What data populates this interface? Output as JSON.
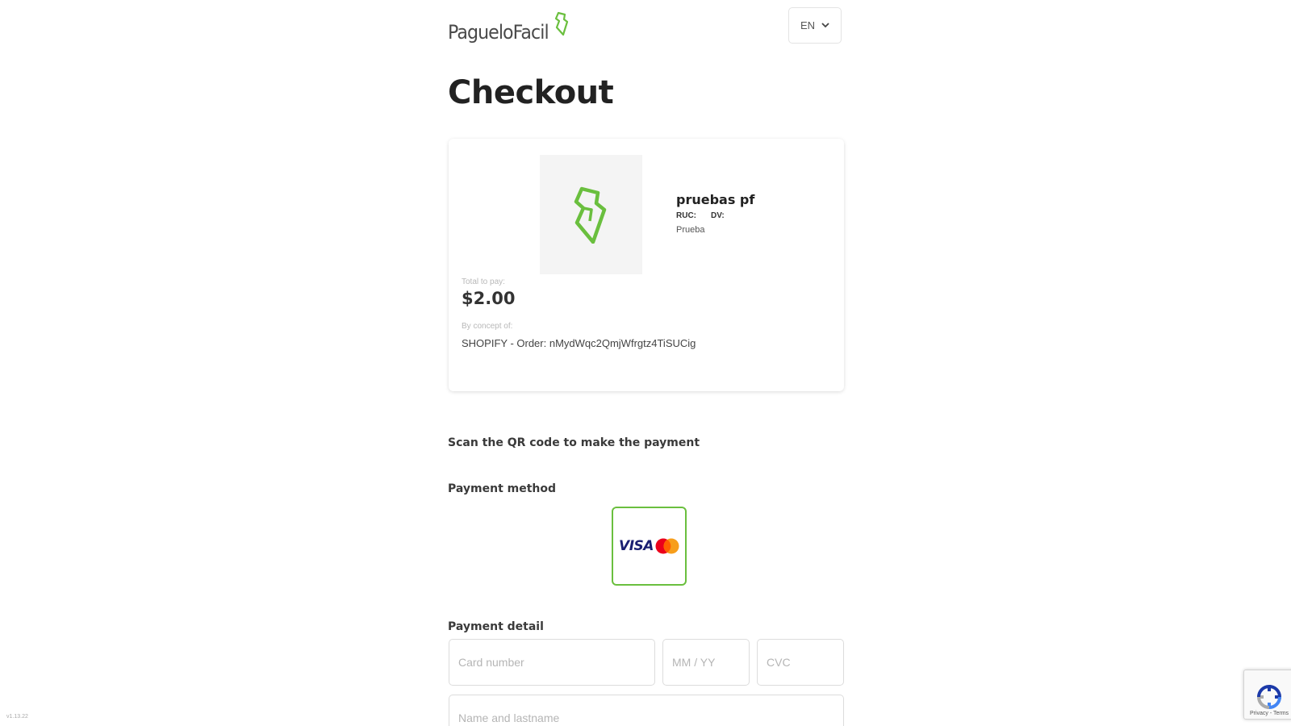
{
  "header": {
    "logo_text": "PagueloFacil",
    "language": "EN"
  },
  "page": {
    "title": "Checkout"
  },
  "merchant": {
    "name": "pruebas pf",
    "ruc_label": "RUC:",
    "dv_label": "DV:",
    "description": "Prueba"
  },
  "payment_summary": {
    "total_label": "Total to pay:",
    "total_amount": "$2.00",
    "concept_label": "By concept of:",
    "concept_value": "SHOPIFY - Order: nMydWqc2QmjWfrgtz4TiSUCig"
  },
  "qr_section": {
    "label": "Scan the QR code to make the payment"
  },
  "payment_method": {
    "label": "Payment method",
    "card_brand_text": "VISA",
    "selected_color": "#6abf3e"
  },
  "payment_detail": {
    "label": "Payment detail",
    "card_number_placeholder": "Card number",
    "expiry_placeholder": "MM / YY",
    "cvc_placeholder": "CVC",
    "name_placeholder": "Name and lastname"
  },
  "recaptcha": {
    "links": "Privacy - Terms"
  },
  "footer": {
    "version": "v1.13.22"
  },
  "colors": {
    "brand_green": "#6abf3e",
    "visa_blue": "#1a1f71",
    "mastercard_red": "#eb001b",
    "mastercard_orange": "#f79e1b"
  }
}
